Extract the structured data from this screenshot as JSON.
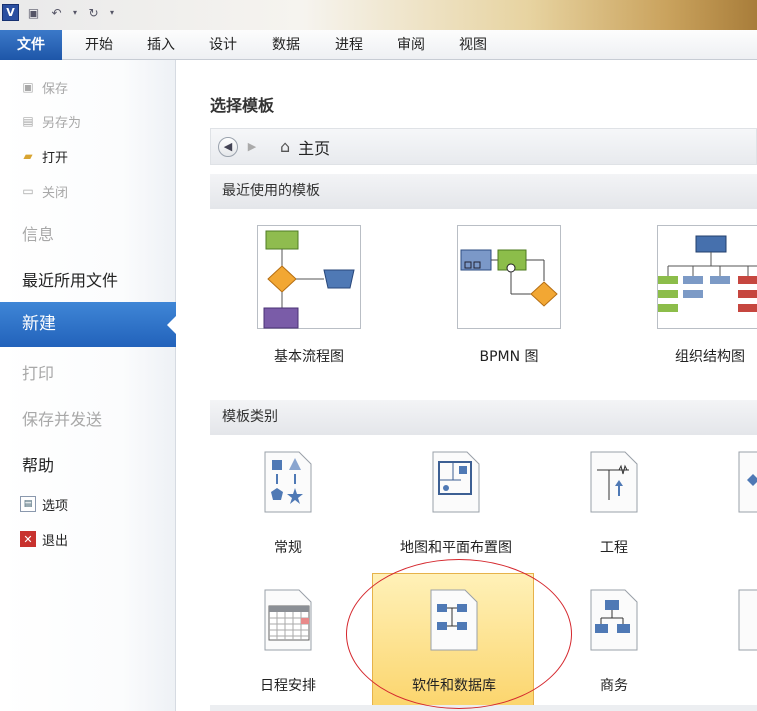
{
  "sidebar": {
    "save": "保存",
    "save_as": "另存为",
    "open": "打开",
    "close": "关闭",
    "info": "信息",
    "recent": "最近所用文件",
    "new": "新建",
    "print": "打印",
    "save_send": "保存并发送",
    "help": "帮助",
    "options": "选项",
    "exit": "退出"
  },
  "ribbon": {
    "tabs": [
      "文件",
      "开始",
      "插入",
      "设计",
      "数据",
      "进程",
      "审阅",
      "视图"
    ]
  },
  "main": {
    "title": "选择模板",
    "nav_home": "主页",
    "recent_header": "最近使用的模板",
    "recent_templates": [
      "基本流程图",
      "BPMN 图",
      "组织结构图"
    ],
    "category_header": "模板类别",
    "categories": [
      "常规",
      "地图和平面布置图",
      "工程",
      "",
      "日程安排",
      "软件和数据库",
      "商务"
    ]
  },
  "colors": {
    "accent": "#2262bb",
    "highlight": "#fbd46a",
    "annotation": "#d5282e"
  }
}
